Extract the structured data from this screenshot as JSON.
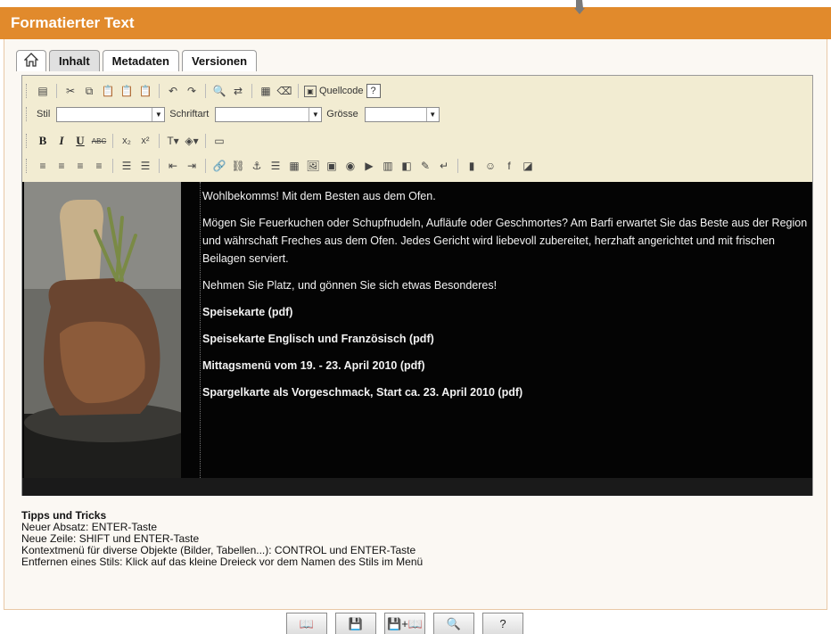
{
  "header": {
    "title": "Formatierter Text"
  },
  "tabs": [
    {
      "label": "Inhalt"
    },
    {
      "label": "Metadaten"
    },
    {
      "label": "Versionen"
    }
  ],
  "toolbar": {
    "quellcode_label": "Quellcode",
    "stil_label": "Stil",
    "schriftart_label": "Schriftart",
    "groesse_label": "Grösse",
    "bold": "B",
    "italic": "I",
    "underline": "U",
    "strike": "ABC",
    "subscript": "x₂",
    "superscript": "x²"
  },
  "content": {
    "paragraphs": [
      "Wohlbekomms! Mit dem Besten aus dem Ofen.",
      "Mögen Sie Feuerkuchen oder Schupfnudeln, Aufläufe oder Geschmortes? Am Barfi erwartet Sie das Beste aus der Region und währschaft Freches aus dem Ofen. Jedes Gericht wird liebevoll zubereitet, herzhaft angerichtet und mit frischen Beilagen serviert.",
      "Nehmen Sie Platz, und gönnen Sie sich etwas Besonderes!"
    ],
    "links": [
      "Speisekarte (pdf)",
      "Speisekarte Englisch und Französisch (pdf)",
      "Mittagsmenü vom 19. - 23. April 2010 (pdf)",
      "Spargelkarte als Vorgeschmack, Start ca. 23. April 2010 (pdf)"
    ]
  },
  "tips": {
    "title": "Tipps und Tricks",
    "lines": [
      "Neuer Absatz: ENTER-Taste",
      "Neue Zeile: SHIFT und ENTER-Taste",
      "Kontextmenü für diverse Objekte (Bilder, Tabellen...): CONTROL und ENTER-Taste",
      "Entfernen eines Stils: Klick auf das kleine Dreieck vor dem Namen des Stils im Menü"
    ]
  },
  "bottom_buttons": [
    "book-icon",
    "save-icon",
    "save-book-icon",
    "preview-icon",
    "?"
  ],
  "colors": {
    "header": "#e18a2c",
    "editor_bg": "#040404",
    "toolbar": "#f2ecd2"
  }
}
